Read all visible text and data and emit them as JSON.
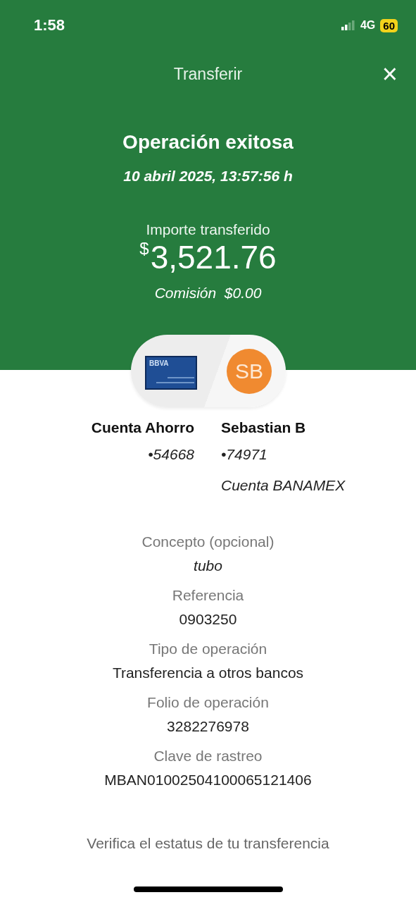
{
  "status_bar": {
    "time": "1:58",
    "network": "4G",
    "battery": "60"
  },
  "header": {
    "title": "Transferir",
    "close": "×"
  },
  "result": {
    "title": "Operación exitosa",
    "datetime": "10 abril 2025, 13:57:56 h",
    "amount_label": "Importe transferido",
    "currency": "$",
    "amount": "3,521.76",
    "commission": "Comisión  $0.00"
  },
  "origin": {
    "card_label": "BBVA",
    "name": "Cuenta Ahorro",
    "number": "•54668"
  },
  "destination": {
    "initials": "SB",
    "name": "Sebastian B",
    "number": "•74971",
    "bank": "Cuenta BANAMEX"
  },
  "details": [
    {
      "label": "Concepto (opcional)",
      "value": "tubo",
      "kind": "italic"
    },
    {
      "label": "Referencia",
      "value": "0903250",
      "kind": "plain"
    },
    {
      "label": "Tipo de operación",
      "value": "Transferencia a otros bancos",
      "kind": "plain"
    },
    {
      "label": "Folio de operación",
      "value": "3282276978",
      "kind": "plain"
    },
    {
      "label": "Clave de rastreo",
      "value": "MBAN01002504100065121406",
      "kind": "plain"
    }
  ],
  "footer_link": "Verifica el estatus de tu transferencia"
}
